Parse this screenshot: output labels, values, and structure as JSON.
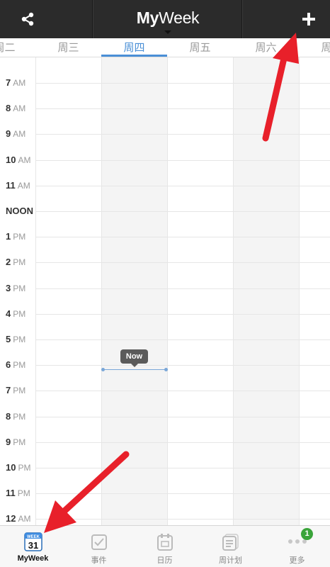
{
  "header": {
    "title_bold": "My",
    "title_regular": "Week",
    "share_icon": "share-icon",
    "add_icon": "plus-icon"
  },
  "days": [
    {
      "label": "周二",
      "active": false
    },
    {
      "label": "周三",
      "active": false
    },
    {
      "label": "周四",
      "active": true
    },
    {
      "label": "周五",
      "active": false
    },
    {
      "label": "周六",
      "active": false
    },
    {
      "label": "周日",
      "active": false
    }
  ],
  "hours": [
    {
      "h": "7",
      "ap": "AM"
    },
    {
      "h": "8",
      "ap": "AM"
    },
    {
      "h": "9",
      "ap": "AM"
    },
    {
      "h": "10",
      "ap": "AM"
    },
    {
      "h": "11",
      "ap": "AM"
    },
    {
      "h": "NOON",
      "ap": ""
    },
    {
      "h": "1",
      "ap": "PM"
    },
    {
      "h": "2",
      "ap": "PM"
    },
    {
      "h": "3",
      "ap": "PM"
    },
    {
      "h": "4",
      "ap": "PM"
    },
    {
      "h": "5",
      "ap": "PM"
    },
    {
      "h": "6",
      "ap": "PM"
    },
    {
      "h": "7",
      "ap": "PM"
    },
    {
      "h": "8",
      "ap": "PM"
    },
    {
      "h": "9",
      "ap": "PM"
    },
    {
      "h": "10",
      "ap": "PM"
    },
    {
      "h": "11",
      "ap": "PM"
    },
    {
      "h": "12",
      "ap": "AM"
    }
  ],
  "now_label": "Now",
  "tabs": [
    {
      "label": "MyWeek",
      "icon": "calendar-week-icon",
      "active": true,
      "icon_top": "WEEK",
      "icon_num": "31"
    },
    {
      "label": "事件",
      "icon": "checkbox-icon",
      "active": false
    },
    {
      "label": "日历",
      "icon": "calendar-icon",
      "active": false
    },
    {
      "label": "周计划",
      "icon": "list-icon",
      "active": false
    },
    {
      "label": "更多",
      "icon": "more-icon",
      "active": false,
      "badge": "1"
    }
  ],
  "colors": {
    "topbar": "#2b2b2b",
    "accent": "#4a8fd6",
    "badge": "#3aa43a",
    "annotation_arrow": "#e8202a"
  }
}
